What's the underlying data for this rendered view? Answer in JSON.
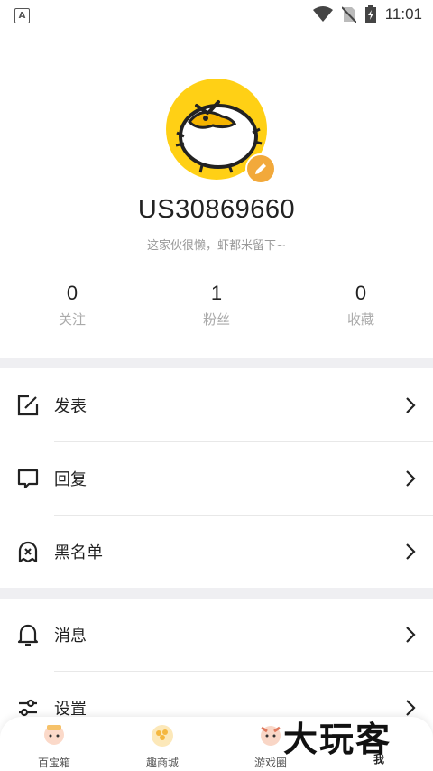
{
  "status_bar": {
    "time": "11:01",
    "left_icon": "A"
  },
  "profile": {
    "username": "US30869660",
    "bio": "这家伙很懒，虾都米留下~",
    "stats": [
      {
        "value": "0",
        "label": "关注"
      },
      {
        "value": "1",
        "label": "粉丝"
      },
      {
        "value": "0",
        "label": "收藏"
      }
    ]
  },
  "menu": {
    "items": [
      {
        "label": "发表",
        "icon": "compose-icon"
      },
      {
        "label": "回复",
        "icon": "reply-icon"
      },
      {
        "label": "黑名单",
        "icon": "blacklist-icon"
      },
      {
        "label": "消息",
        "icon": "bell-icon"
      },
      {
        "label": "设置",
        "icon": "settings-icon"
      }
    ]
  },
  "tabbar": {
    "tabs": [
      {
        "label": "百宝箱"
      },
      {
        "label": "趣商城"
      },
      {
        "label": "游戏圈"
      },
      {
        "label": "我"
      }
    ]
  },
  "watermark": "大玩客",
  "colors": {
    "accent": "#ffd015",
    "badge": "#f2a93b",
    "divider": "#efeff2"
  }
}
